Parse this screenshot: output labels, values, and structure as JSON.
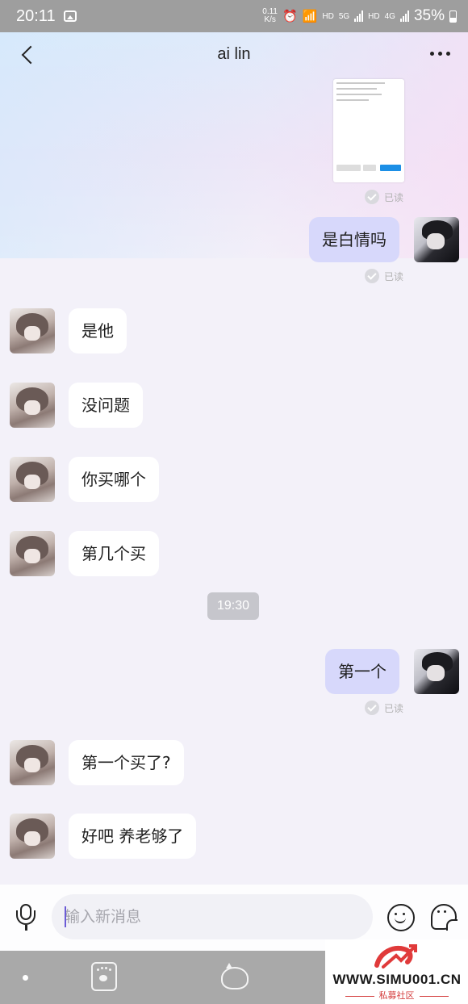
{
  "status_bar": {
    "time": "20:11",
    "net_speed_value": "0.11",
    "net_speed_unit": "K/s",
    "hd1": "HD",
    "net1": "5G",
    "hd2": "HD",
    "net2": "4G",
    "battery": "35%"
  },
  "header": {
    "title": "ai lin"
  },
  "read_label": "已读",
  "messages": {
    "m1": "是白情吗",
    "m2": "是他",
    "m3": "没问题",
    "m4": "你买哪个",
    "m5": "第几个买",
    "m6": "第一个",
    "m7": "第一个买了?",
    "m8": "好吧 养老够了"
  },
  "time_divider": "19:30",
  "composer": {
    "placeholder": "输入新消息"
  },
  "watermark": {
    "site": "WWW.SIMU001.CN",
    "sub": "私募社区"
  },
  "colors": {
    "bubble_out": "#d7d8fb",
    "bubble_in": "#ffffff",
    "accent": "#6b5bd6"
  }
}
